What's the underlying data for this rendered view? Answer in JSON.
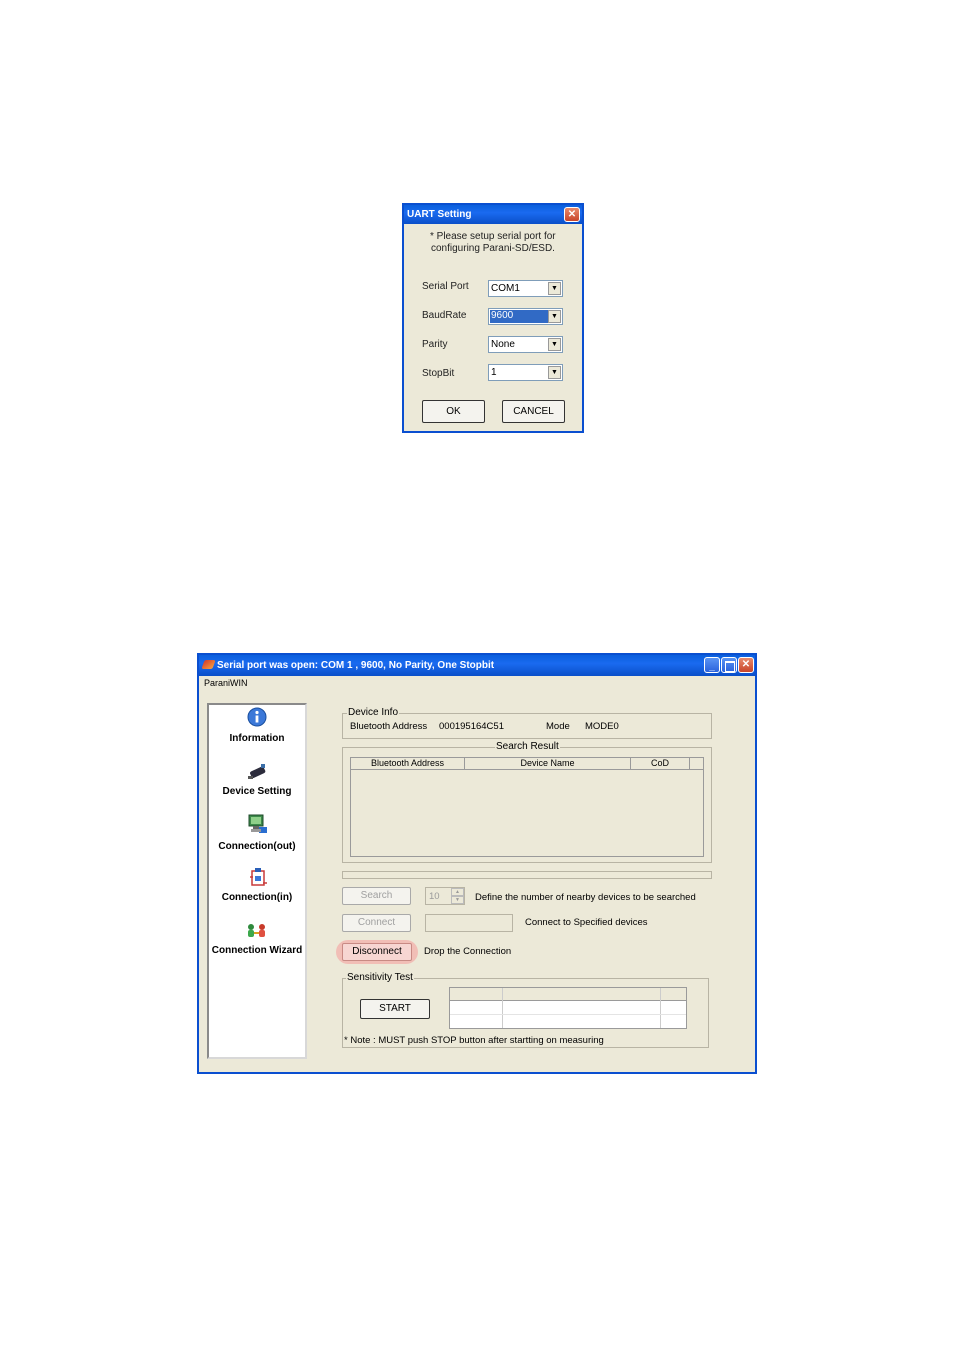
{
  "uart_dialog": {
    "title": "UART Setting",
    "instruction_line1": "* Please setup serial port for",
    "instruction_line2": "configuring Parani-SD/ESD.",
    "fields": [
      {
        "label": "Serial Port",
        "value": "COM1"
      },
      {
        "label": "BaudRate",
        "value": "9600"
      },
      {
        "label": "Parity",
        "value": "None"
      },
      {
        "label": "StopBit",
        "value": "1"
      }
    ],
    "ok_label": "OK",
    "cancel_label": "CANCEL"
  },
  "main_window": {
    "title": "Serial port was open: COM 1 , 9600, No Parity, One Stopbit",
    "menu_label": "ParaniWIN",
    "nav": [
      {
        "label": "Information",
        "icon": "information-icon"
      },
      {
        "label": "Device Setting",
        "icon": "device-setting-icon"
      },
      {
        "label": "Connection(out)",
        "icon": "connection-out-icon"
      },
      {
        "label": "Connection(in)",
        "icon": "connection-in-icon"
      },
      {
        "label": "Connection Wizard",
        "icon": "connection-wizard-icon"
      }
    ],
    "device_info": {
      "legend": "Device Info",
      "address_label": "Bluetooth Address",
      "address_value": "000195164C51",
      "mode_label": "Mode",
      "mode_value": "MODE0"
    },
    "search_result": {
      "legend": "Search Result",
      "columns": [
        "Bluetooth Address",
        "Device Name",
        "CoD"
      ]
    },
    "search_button": "Search",
    "search_count": "10",
    "search_desc": "Define the number of nearby devices to be searched",
    "connect_button": "Connect",
    "connect_desc": "Connect to Specified devices",
    "disconnect_button": "Disconnect",
    "disconnect_desc": "Drop the Connection",
    "sensitivity": {
      "legend": "Sensitivity Test",
      "start_button": "START",
      "note": "* Note : MUST push STOP button after startting on measuring"
    }
  },
  "colors": {
    "xp_blue": "#0a4fd0",
    "window_bg": "#ece9d8",
    "close_red": "#c8452a",
    "disconnect_highlight": "#f2b6b0",
    "selection_blue": "#316ac5"
  }
}
